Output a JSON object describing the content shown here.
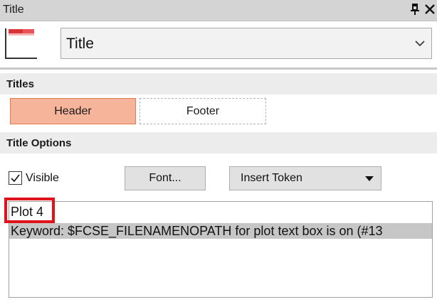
{
  "window": {
    "title": "Title",
    "pin_icon": "pin-icon",
    "close_icon": "close-icon"
  },
  "header": {
    "icon": "title-block-icon",
    "dropdown_value": "Title",
    "dropdown_icon": "chevron-down-icon"
  },
  "sections": {
    "titles_label": "Titles",
    "title_options_label": "Title Options"
  },
  "titles_toggle": {
    "header_label": "Header",
    "footer_label": "Footer",
    "selected": "Header"
  },
  "options": {
    "visible_label": "Visible",
    "visible_checked": true,
    "font_button_label": "Font...",
    "insert_token_label": "Insert Token"
  },
  "text_box": {
    "line1": "Plot 4",
    "line2": "Keyword: $FCSE_FILENAMENOPATH for plot text box is on (#13"
  },
  "colors": {
    "accent_selected_bg": "#f6b49b",
    "accent_selected_border": "#e37a54",
    "annotation_red": "#e0131b",
    "line_highlight": "#c6c6c6"
  }
}
